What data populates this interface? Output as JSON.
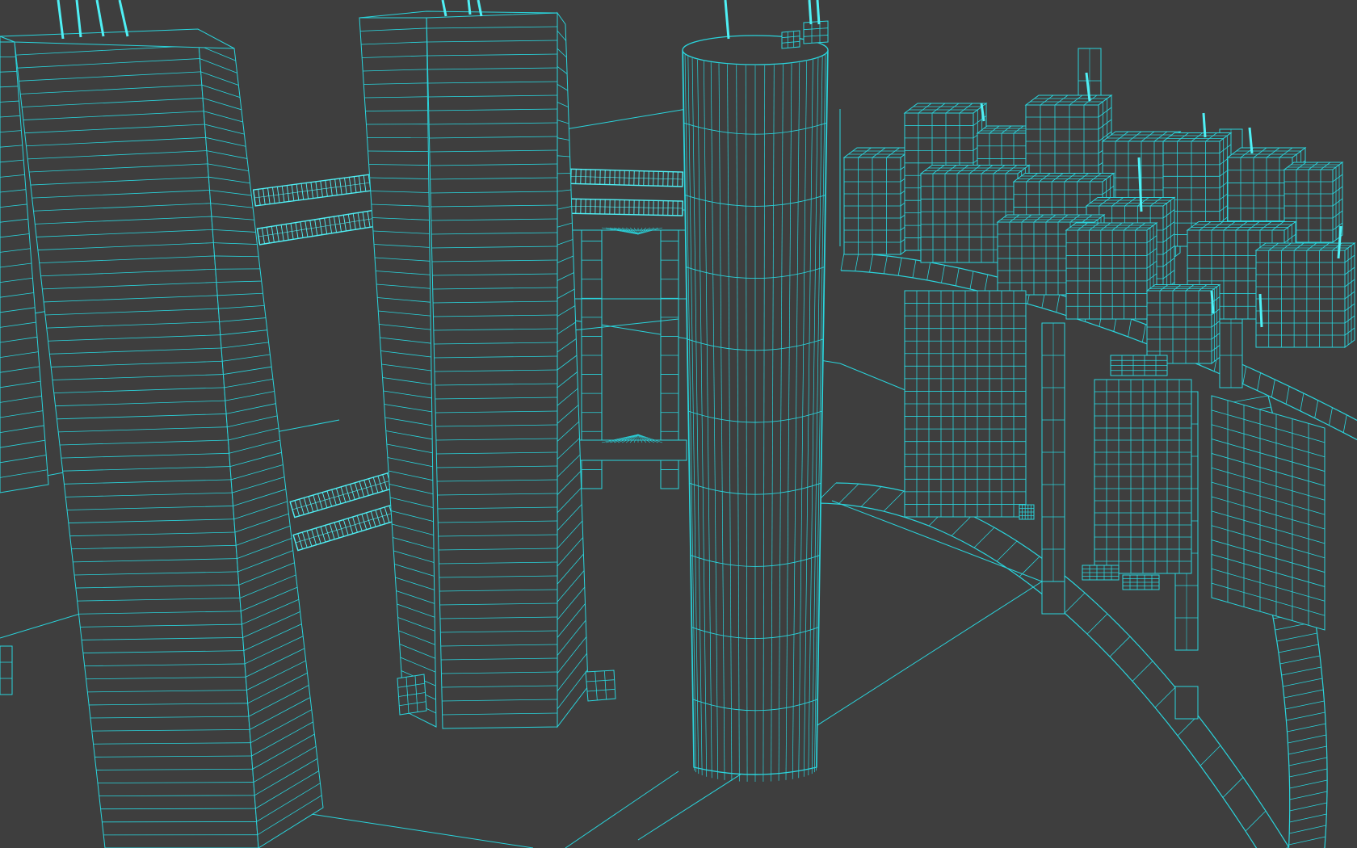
{
  "scene": {
    "kind": "wireframe-3d-city",
    "colors": {
      "background": "#3e3e3e",
      "wire": "#2ad4dc",
      "wire_bright": "#4ff0f5"
    },
    "objects": [
      "left-skyscraper",
      "middle-skyscraper",
      "cylinder-tower",
      "sky-bridges",
      "portal-frame",
      "curved-ring-walkway",
      "background-city-blocks",
      "rooftop-antennas"
    ]
  }
}
